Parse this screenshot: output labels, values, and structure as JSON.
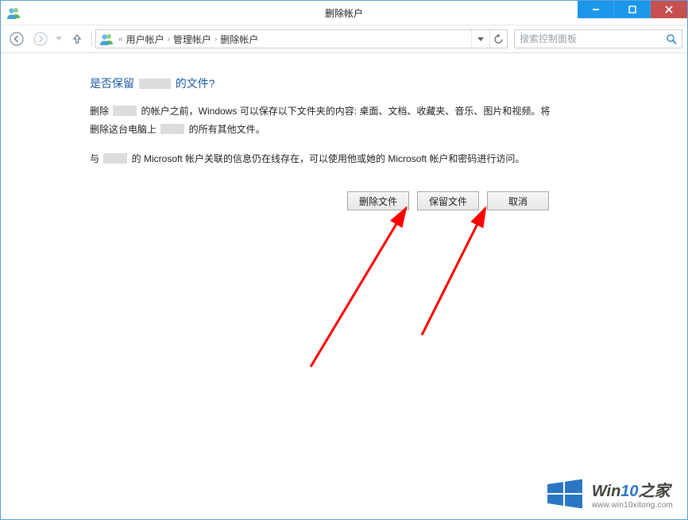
{
  "window": {
    "title": "删除帐户"
  },
  "navbar": {
    "breadcrumbs": [
      "用户帐户",
      "管理帐户",
      "删除帐户"
    ],
    "search_placeholder": "搜索控制面板"
  },
  "content": {
    "heading_pre": "是否保留 ",
    "heading_post": " 的文件?",
    "para1_a": "删除 ",
    "para1_b": " 的帐户之前，Windows 可以保存以下文件夹的内容: 桌面、文档、收藏夹、音乐、图片和视频。将删除这台电脑上 ",
    "para1_c": " 的所有其他文件。",
    "para2_a": "与 ",
    "para2_b": " 的 Microsoft 帐户关联的信息仍在线存在，可以使用他或她的 Microsoft 帐户和密码进行访问。"
  },
  "buttons": {
    "delete_files": "删除文件",
    "keep_files": "保留文件",
    "cancel": "取消"
  },
  "watermark": {
    "title_a": "Win",
    "title_b": "10",
    "title_c": "之家",
    "url": "www.win10xitong.com"
  }
}
